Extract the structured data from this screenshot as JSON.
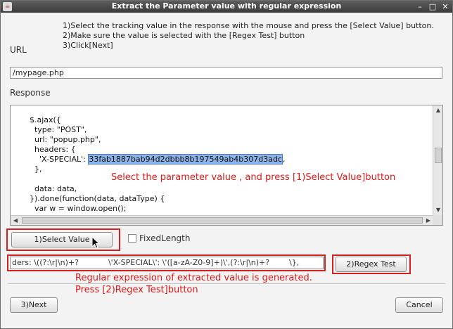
{
  "window": {
    "title": "Extract the Parameter value with regular expression",
    "controls": [
      "–",
      "□",
      "✕"
    ]
  },
  "instructions": [
    "1)Select the tracking value in the response with the mouse and press the [Select Value] button.",
    "2)Make sure the value is selected with the [Regex Test] button",
    "3)Click[Next]"
  ],
  "url": {
    "label": "URL",
    "value": "/mypage.php"
  },
  "response": {
    "label": "Response",
    "code_lines": [
      "  $.ajax({",
      "    type: \"POST\",",
      "    url: \"popup.php\",",
      "    headers: {",
      "      'X-SPECIAL': ",
      "    },",
      "",
      "    data: data,",
      "  }).done(function(data, dataType) {",
      "    var w = window.open();"
    ],
    "selected_value": "33fab1887bab94d2dbbb8b197549ab4b307d3adc",
    "after_selected": ","
  },
  "annotations": {
    "select_hint": "Select the parameter value , and press [1)Select Value]button",
    "regex_hint_line1": "Regular expression of extracted value is generated.",
    "regex_hint_line2": "Press [2)Regex Test]button"
  },
  "buttons": {
    "select_value": "1)Select Value",
    "fixed_length": "FixedLength",
    "regex_test": "2)Regex Test",
    "next": "3)Next",
    "cancel": "Cancel"
  },
  "regex": {
    "value": "ders: \\((?:\\r|\\n)+?            \\'X-SPECIAL\\': \\'([a-zA-Z0-9]+)\\',(?:\\r|\\n)+?        \\},"
  },
  "colors": {
    "annotation": "#e01818",
    "selection": "#8db3e8"
  }
}
